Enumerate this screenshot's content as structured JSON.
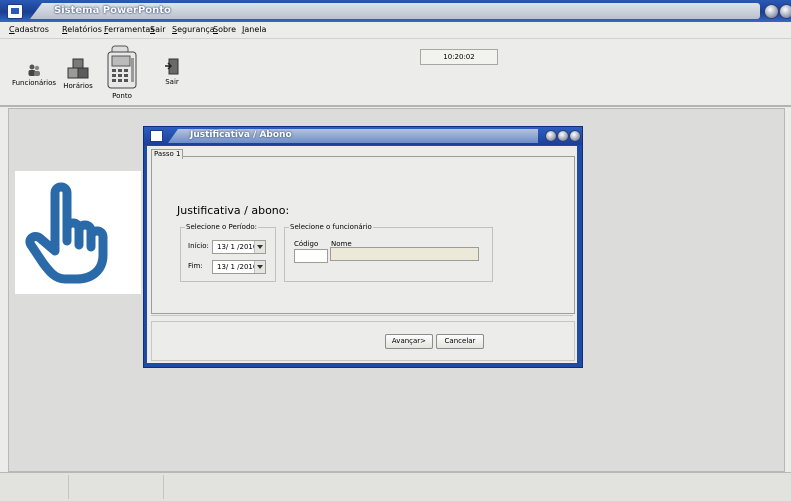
{
  "app": {
    "title": "Sistema PowerPonto"
  },
  "menu": [
    "Cadastros",
    "Relatórios",
    "Ferramentas",
    "Sair",
    "Segurança",
    "Sobre",
    "Janela"
  ],
  "toolbar": {
    "funcionarios": "Funcionários",
    "horarios": "Horários",
    "ponto": "Ponto",
    "sair": "Sair"
  },
  "clock": "10:20:02",
  "dialog": {
    "title": "Justificativa / Abono",
    "tab": "Passo 1",
    "heading": "Justificativa / abono:",
    "period_group": "Selecione o Período:",
    "inicio_label": "Início:",
    "inicio_value": "13/ 1 /2010",
    "fim_label": "Fim:",
    "fim_value": "13/ 1 /2010",
    "employee_group": "Selecione o funcionário",
    "codigo_label": "Código",
    "nome_label": "Nome",
    "codigo_value": "",
    "nome_value": "",
    "next_button": "Avançar>",
    "cancel_button": "Cancelar"
  },
  "colors": {
    "title_blue": "#1f4aa6",
    "hand_blue": "#2a6aa8",
    "name_field": "#ece9d8"
  }
}
